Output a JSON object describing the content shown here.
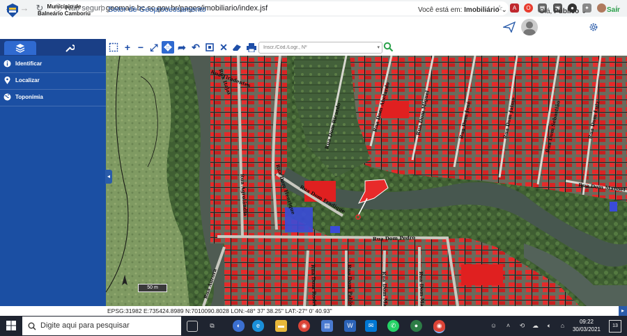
{
  "browser": {
    "insecure_label": "Não seguro",
    "url": "geomais.bc.sc.gov.br/pages/imobiliario/index.jsf"
  },
  "header": {
    "municipality_line1": "Município de",
    "municipality_line2": "Balneário Camboriú",
    "sector_title": "Setor de Geoprocessamento",
    "location_prefix": "Você está em:",
    "location_value": "Imobiliário",
    "greeting": "Olá,",
    "user": "Público",
    "logout": "Sair"
  },
  "sidebar": {
    "items": [
      {
        "label": "Identificar",
        "icon": "info-icon"
      },
      {
        "label": "Localizar",
        "icon": "map-pin-icon"
      },
      {
        "label": "Toponímia",
        "icon": "globe-icon"
      }
    ]
  },
  "toolbar": {
    "search_placeholder": "Inscr./Cód./Logr., Nº"
  },
  "map": {
    "streets": [
      "Rua Dom Ricardo",
      "Rua Dom Abelardo",
      "Rua Dom Miguel",
      "Rua Dom José",
      "Rua Dom Jaime",
      "Rua Dom Sebastião",
      "Rua Dom Luiz",
      "Rua Dom Manoel",
      "Rua Dom Henrique",
      "Rua Dom Fradique",
      "Rua Dom Pedro",
      "Rua Agrolândia",
      "Rua Dom Rodrigo",
      "Rua Dom Pablo",
      "Rua Dom Mateus",
      "Rua Dom Marcos",
      "Rua Aurora",
      "Rua Tiradentes",
      "Rua Itajaí"
    ],
    "scale": "50 m",
    "coords": "EPSG:31982 E:735424.8989 N:7010090.8028 LON:-48° 37' 38.25\" LAT:-27° 0' 40.93\""
  },
  "taskbar": {
    "search_placeholder": "Digite aqui para pesquisar",
    "time": "09:22",
    "date": "30/03/2021",
    "notifications": "13"
  },
  "colors": {
    "sidebar": "#1b4fa3",
    "accent": "#2a5caa",
    "parcel": "#e02020",
    "logout": "#2aa14a"
  }
}
